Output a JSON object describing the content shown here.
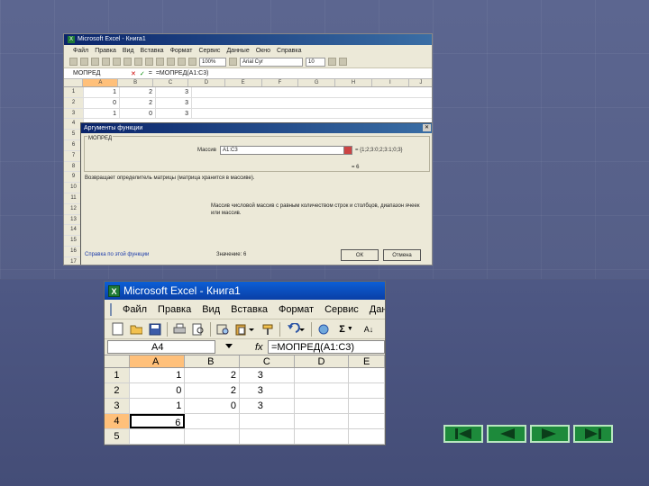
{
  "shot1": {
    "title": "Microsoft Excel - Книга1",
    "menu": [
      "Файл",
      "Правка",
      "Вид",
      "Вставка",
      "Формат",
      "Сервис",
      "Данные",
      "Окно",
      "Справка"
    ],
    "zoom": "100%",
    "font_name": "Arial Cyr",
    "font_size": "10",
    "name_box": "МОПРЕД",
    "formula": "=МОПРЕД(A1:C3)",
    "col_headers": [
      "A",
      "B",
      "C",
      "D",
      "E",
      "F",
      "G",
      "H",
      "I",
      "J"
    ],
    "rows": [
      {
        "n": "1",
        "a": "1",
        "b": "2",
        "c": "3"
      },
      {
        "n": "2",
        "a": "0",
        "b": "2",
        "c": "3"
      },
      {
        "n": "3",
        "a": "1",
        "b": "0",
        "c": "3"
      }
    ],
    "row_numbers": [
      "4",
      "5",
      "6",
      "7",
      "8",
      "9",
      "10",
      "11",
      "12",
      "13",
      "14",
      "15",
      "16",
      "17"
    ],
    "dialog": {
      "title": "Аргументы функции",
      "group_label": "МОПРЕД",
      "field_label": "Массив",
      "field_value": "A1:C3",
      "field_result": "= {1;2;3:0;2;3:1;0;3}",
      "result": "= 6",
      "description": "Возвращает определитель матрицы (матрица хранится в массиве).",
      "help_text": "Массив  числовой массив с равным количеством строк и столбцов, диапазон ячеек или массив.",
      "help_link": "Справка по этой функции",
      "value_label": "Значение: 6",
      "ok": "ОК",
      "cancel": "Отмена"
    }
  },
  "shot2": {
    "title": "Microsoft Excel - Книга1",
    "menu": [
      "Файл",
      "Правка",
      "Вид",
      "Вставка",
      "Формат",
      "Сервис",
      "Дан"
    ],
    "name_box": "A4",
    "fx": "fx",
    "formula": "=МОПРЕД(A1:C3)",
    "col_headers": [
      "A",
      "B",
      "C",
      "D",
      "E"
    ],
    "rows": [
      {
        "n": "1",
        "a": "1",
        "b": "2",
        "c": "3"
      },
      {
        "n": "2",
        "a": "0",
        "b": "2",
        "c": "3"
      },
      {
        "n": "3",
        "a": "1",
        "b": "0",
        "c": "3"
      },
      {
        "n": "4",
        "a": "6",
        "b": "",
        "c": ""
      },
      {
        "n": "5",
        "a": "",
        "b": "",
        "c": ""
      }
    ]
  },
  "nav": [
    "first",
    "prev",
    "next",
    "last"
  ],
  "colors": {
    "nav_green": "#1d8a3b",
    "title_blue": "#0a3fa6",
    "active_header": "#ffc07a"
  }
}
